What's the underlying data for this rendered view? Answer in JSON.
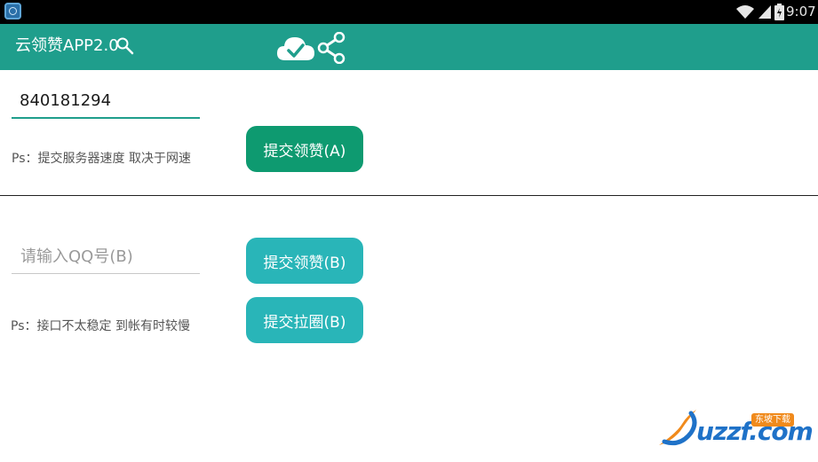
{
  "status_bar": {
    "time": "9:07",
    "icons": [
      "app-icon",
      "wifi-icon",
      "signal-icon",
      "battery-icon"
    ]
  },
  "action_bar": {
    "title": "云领赞APP2.0",
    "icons": [
      "search-icon",
      "cloud-check-icon",
      "share-icon"
    ]
  },
  "section_a": {
    "qq_input_value": "840181294",
    "hint": "Ps：提交服务器速度 取决于网速",
    "submit_like_label": "提交领赞(A)"
  },
  "section_b": {
    "qq_input_placeholder": "请输入QQ号(B)",
    "qq_input_value": "",
    "submit_like_label": "提交领赞(B)",
    "submit_circle_label": "提交拉圈(B)",
    "hint": "Ps：接口不太稳定 到帐有时较慢"
  },
  "watermark": {
    "text": "uzzf.com",
    "tag": "东坡下载"
  },
  "colors": {
    "action_bar": "#1f9e8c",
    "button_a": "#0e9a70",
    "button_b": "#29b5b8",
    "status_bar": "#000000"
  }
}
